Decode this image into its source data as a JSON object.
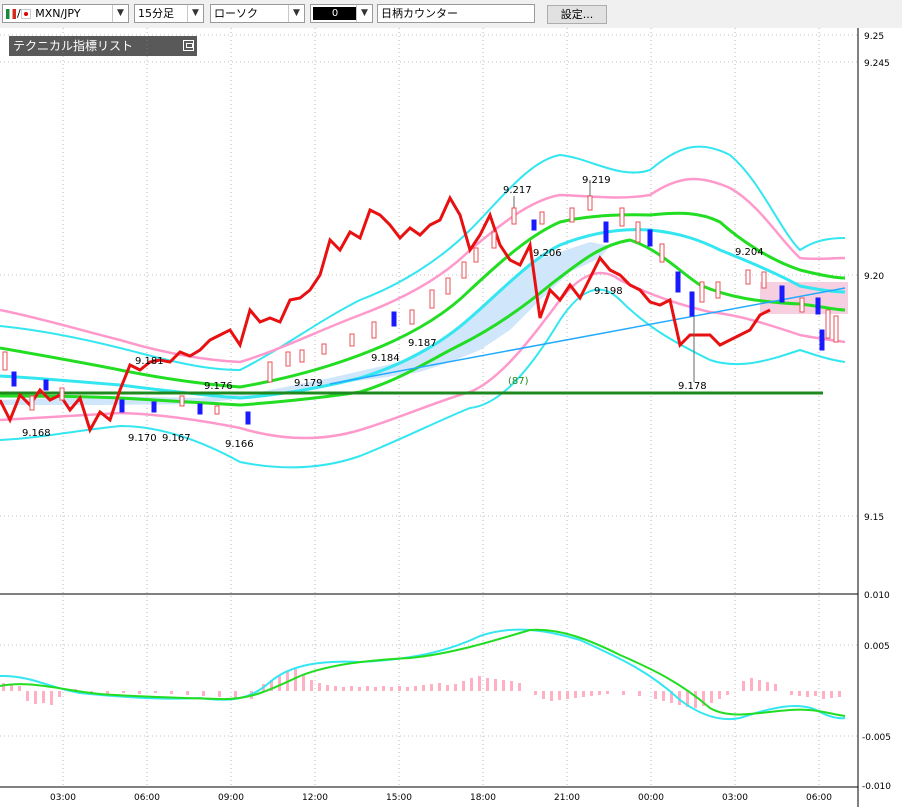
{
  "toolbar": {
    "pair": "MXN/JPY",
    "pair_separator": "/",
    "timeframe": "15分足",
    "chart_style": "ローソク",
    "color_swatch": "0",
    "counter_label": "日柄カウンター",
    "settings_label": "設定..."
  },
  "panel": {
    "title": "テクニカル指標リスト"
  },
  "colors": {
    "bull_candle": "#e8505a",
    "bear_candle": "#1a1aff",
    "bollinger_1": "#ff99cc",
    "bollinger_2": "#33e6f0",
    "ema_fast": "#33e6f0",
    "ema_slow": "#22dd22",
    "cloud": "#cfe6fb",
    "line_red": "#e81010",
    "trend_blue": "#22aaff",
    "horizontal": "#1e8a1e",
    "macd_hist": "#ffb0c4"
  },
  "chart_data": {
    "type": "candlestick",
    "title": "",
    "main_y_ticks": [
      "9.25",
      "9.245",
      "9.20",
      "9.15"
    ],
    "sub_y_ticks": [
      "0.010",
      "0.005",
      "-0.005",
      "-0.010"
    ],
    "x_ticks": [
      "03:00",
      "06:00",
      "09:00",
      "12:00",
      "15:00",
      "18:00",
      "21:00",
      "00:00",
      "03:00",
      "06:00"
    ],
    "price_labels": [
      "9.168",
      "9.181",
      "9.170",
      "9.167",
      "9.176",
      "9.166",
      "9.179",
      "9.184",
      "9.187",
      "9.217",
      "9.206",
      "9.219",
      "9.198",
      "9.204",
      "9.178"
    ],
    "count_label": "(87)",
    "series": [
      {
        "values": [
          9.184,
          9.178,
          9.172,
          9.167,
          9.165,
          9.172,
          9.181,
          9.183,
          9.185,
          9.187,
          9.191,
          9.198,
          9.197,
          9.199,
          9.206,
          9.206,
          9.208,
          9.201,
          9.204,
          9.207,
          9.21,
          9.216,
          9.221,
          9.225,
          9.211,
          9.207,
          9.217,
          9.219,
          9.216,
          9.215,
          9.208,
          9.204,
          9.192,
          9.186,
          9.194,
          9.197,
          9.196,
          9.208,
          9.211,
          9.2,
          9.198,
          9.197,
          9.193,
          9.19,
          9.195,
          9.198,
          9.207,
          9.204,
          9.202,
          9.197,
          9.19,
          9.191,
          9.188,
          9.192,
          9.193,
          9.197,
          9.196,
          9.197,
          9.198,
          9.191,
          9.192,
          9.189,
          9.191,
          9.194,
          9.197,
          9.2,
          9.195,
          9.19
        ]
      }
    ]
  }
}
